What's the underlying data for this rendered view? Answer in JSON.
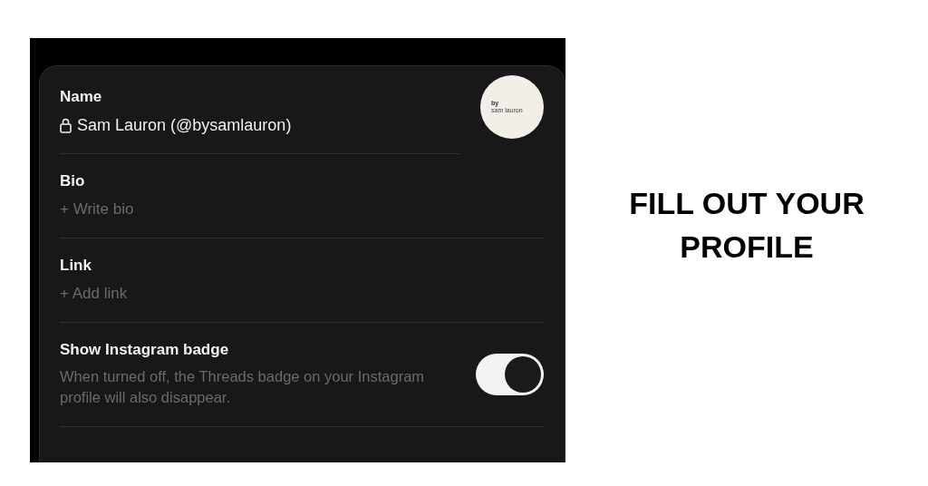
{
  "profile": {
    "name_label": "Name",
    "name_value": "Sam Lauron (@bysamlauron)",
    "locked": true,
    "avatar_text": [
      "by",
      "sam lauron"
    ]
  },
  "fields": [
    {
      "label": "Bio",
      "placeholder": "+ Write bio"
    },
    {
      "label": "Link",
      "placeholder": "+ Add link"
    }
  ],
  "badge_setting": {
    "label": "Show Instagram badge",
    "description": "When turned off, the Threads badge on your Instagram profile will also disappear.",
    "on": true
  },
  "caption": "FILL OUT YOUR PROFILE"
}
